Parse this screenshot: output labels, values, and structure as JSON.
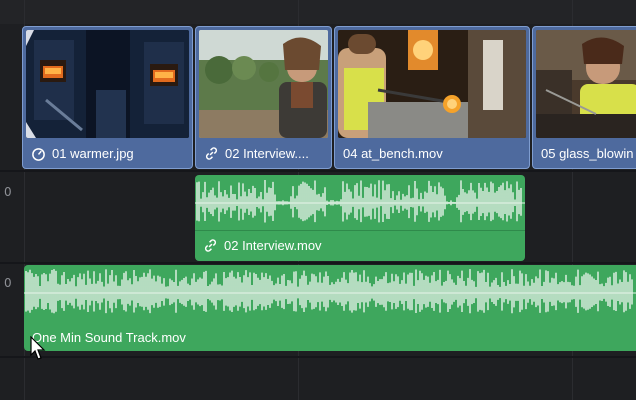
{
  "tracks": {
    "audio1_number": "0",
    "audio2_number": "0"
  },
  "video_clips": [
    {
      "label": "01 warmer.jpg",
      "icon": "speedometer-icon"
    },
    {
      "label": "02 Interview....",
      "icon": "link-icon"
    },
    {
      "label": "04 at_bench.mov",
      "icon": ""
    },
    {
      "label": "05 glass_blowin",
      "icon": ""
    }
  ],
  "audio_clips": [
    {
      "label": "02 Interview.mov",
      "icon": "link-icon"
    },
    {
      "label": "One Min Sound Track.mov",
      "icon": ""
    }
  ],
  "colors": {
    "video_clip": "#4e6a9e",
    "audio_clip": "#3ea75d",
    "background": "#1e1f22"
  }
}
